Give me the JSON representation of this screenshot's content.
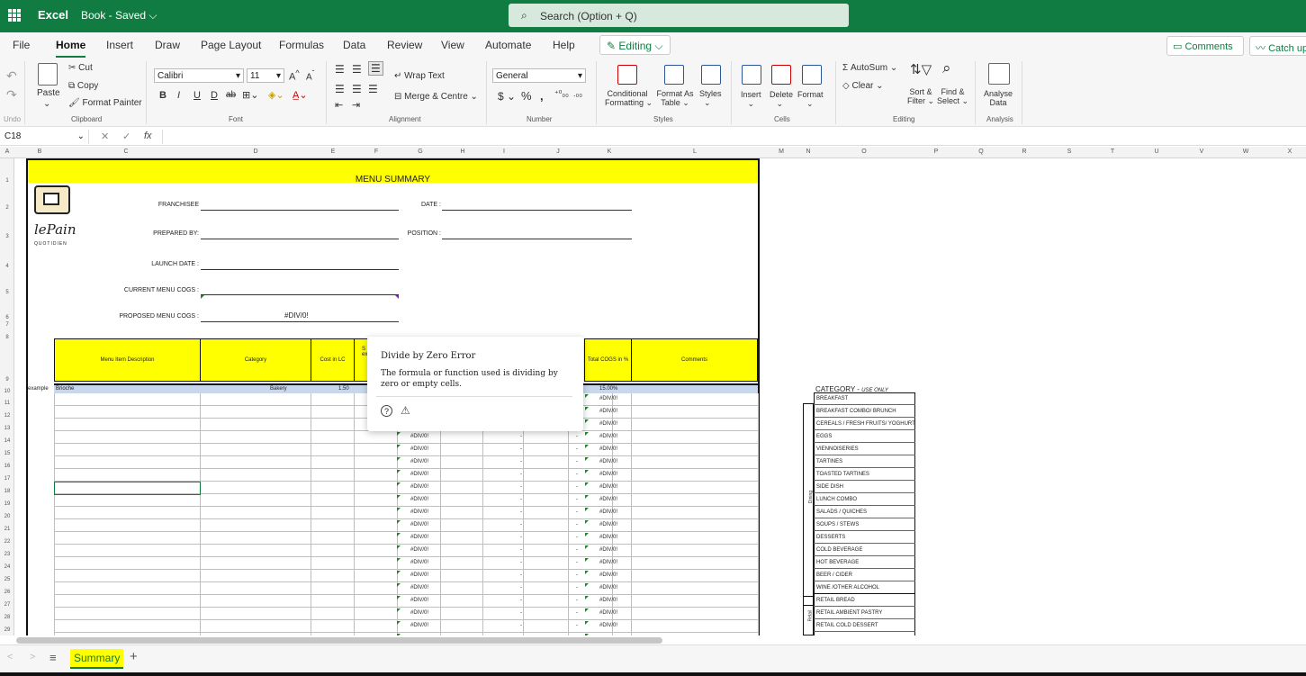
{
  "titlebar": {
    "app": "Excel",
    "doc": "Book - Saved",
    "search_placeholder": "Search (Option + Q)"
  },
  "tabs": [
    "File",
    "Home",
    "Insert",
    "Draw",
    "Page Layout",
    "Formulas",
    "Data",
    "Review",
    "View",
    "Automate",
    "Help"
  ],
  "editing_label": "Editing",
  "comments_label": "Comments",
  "catchup_label": "Catch up",
  "ribbon": {
    "undo": "Undo",
    "clipboard": "Clipboard",
    "paste": "Paste",
    "cut": "Cut",
    "copy": "Copy",
    "format_painter": "Format Painter",
    "font_group": "Font",
    "font_name": "Calibri",
    "font_size": "11",
    "alignment": "Alignment",
    "wrap": "Wrap Text",
    "merge": "Merge & Centre",
    "number_group": "Number",
    "number_format": "General",
    "styles_group": "Styles",
    "cond_fmt": "Conditional",
    "cond_fmt2": "Formatting",
    "fmt_table": "Format As",
    "fmt_table2": "Table",
    "styles": "Styles",
    "cells_group": "Cells",
    "insert": "Insert",
    "delete": "Delete",
    "format": "Format",
    "editing_group": "Editing",
    "autosum": "AutoSum",
    "clear": "Clear",
    "sort": "Sort &",
    "sort2": "Filter",
    "find": "Find &",
    "find2": "Select",
    "analysis_group": "Analysis",
    "analyse": "Analyse",
    "analyse2": "Data"
  },
  "namebox": "C18",
  "columns": [
    "A",
    "B",
    "C",
    "D",
    "E",
    "F",
    "G",
    "H",
    "I",
    "J",
    "K",
    "L",
    "M",
    "N",
    "O",
    "P",
    "Q",
    "R",
    "S",
    "T",
    "U",
    "V",
    "W",
    "X"
  ],
  "rows": [
    "1",
    "2",
    "3",
    "4",
    "5",
    "6",
    "7",
    "8",
    "9",
    "10",
    "11",
    "12",
    "13",
    "14",
    "15",
    "16",
    "17",
    "18",
    "19",
    "20",
    "21",
    "22",
    "23",
    "24",
    "25",
    "26",
    "27",
    "28",
    "29"
  ],
  "sheet": {
    "title": "MENU SUMMARY",
    "franchisee": "FRANCHISEE",
    "date": "DATE :",
    "prepared": "PREPARED  BY:",
    "position": "POSITION :",
    "launch": "LAUNCH DATE :",
    "current_cogs": "CURRENT MENU COGS :",
    "proposed_cogs": "PROPOSED MENU COGS :",
    "proposed_value": "#DIV/0!",
    "logo_text": "QUOTIDIEN",
    "headers": {
      "desc": "Menu Item Description",
      "category": "Category",
      "cost": "Cost in LC",
      "sell_a": "S",
      "sell_b": "ex",
      "total_cogs": "Total COGS in %",
      "comments": "Comments"
    },
    "example": {
      "label": "example",
      "item": "Brioche",
      "category": "Bakery",
      "cost": "1.50",
      "cogs": "15.00%"
    },
    "div0": "#DIV/0!",
    "dash": "-"
  },
  "category": {
    "title": "CATEGORY",
    "note": "USE ONLY",
    "dining_label": "Dining",
    "retail_label": "Retail",
    "items": [
      "BREAKFAST",
      "BREAKFAST COMBO/ BRUNCH",
      "CEREALS / FRESH FRUITS/ YOGHURT",
      "EGGS",
      "VIENNOISERIES",
      "TARTINES",
      "TOASTED TARTINES",
      "SIDE DISH",
      "LUNCH COMBO",
      "SALADS / QUICHES",
      "SOUPS / STEWS",
      "DESSERTS",
      "COLD BEVERAGE",
      "HOT BEVERAGE",
      "BEER / CIDER",
      "WINE /OTHER ALCOHOL",
      "RETAIL BREAD",
      "RETAIL AMBIENT PASTRY",
      "RETAIL COLD DESSERT"
    ]
  },
  "tooltip": {
    "title": "Divide by Zero Error",
    "body": "The formula or function used is dividing by zero or empty cells."
  },
  "sheet_tab": "Summary"
}
